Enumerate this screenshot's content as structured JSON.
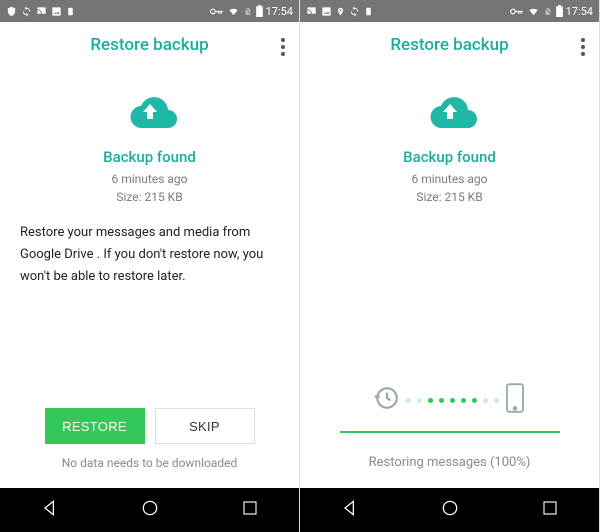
{
  "status": {
    "time": "17:54"
  },
  "left": {
    "title": "Restore backup",
    "backup_title": "Backup found",
    "time_ago": "6 minutes ago",
    "size": "Size: 215 KB",
    "description": "Restore your messages and media from Google Drive . If you don't restore now, you won't be able to restore later.",
    "restore_label": "RESTORE",
    "skip_label": "SKIP",
    "footer": "No data needs to be downloaded"
  },
  "right": {
    "title": "Restore backup",
    "backup_title": "Backup found",
    "time_ago": "6 minutes ago",
    "size": "Size: 215 KB",
    "restoring": "Restoring messages (100%)"
  }
}
